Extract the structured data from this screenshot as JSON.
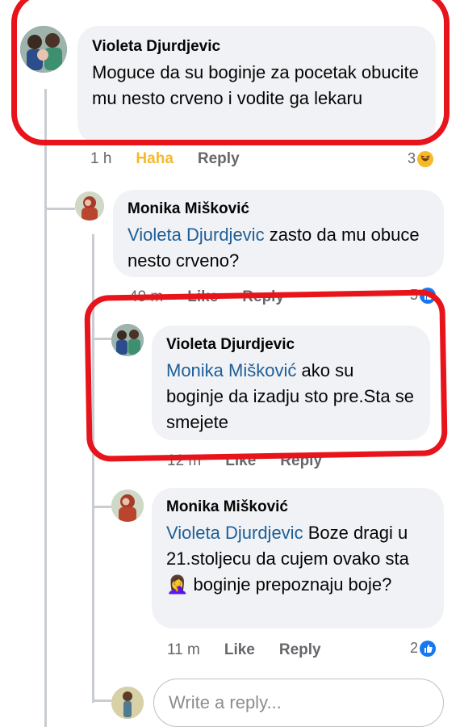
{
  "comments": [
    {
      "author": "Violeta Djurdjevic",
      "mention": "",
      "text": "Moguce da su boginje za pocetak obucite mu nesto crveno i vodite ga lekaru",
      "meta": {
        "time": "1 h",
        "haha": "Haha",
        "reply": "Reply"
      },
      "reaction_count": "3",
      "reaction_type": "haha-icon"
    },
    {
      "author": "Monika Mišković",
      "mention": "Violeta Djurdjevic",
      "text": " zasto da mu obuce nesto crveno?",
      "meta": {
        "time": "49 m",
        "like": "Like",
        "reply": "Reply"
      },
      "reaction_count": "5",
      "reaction_type": "like-icon"
    },
    {
      "author": "Violeta Djurdjevic",
      "mention": "Monika Mišković",
      "text": " ako su boginje da izadju sto pre.Sta se smejete",
      "meta": {
        "time": "12 m",
        "like": "Like",
        "reply": "Reply"
      }
    },
    {
      "author": "Monika Mišković",
      "mention": "Violeta Djurdjevic",
      "text_part1": " Boze dragi u 21.stoljecu da cujem ovako sta ",
      "emoji": "🤦‍♀️",
      "text_part2": " boginje prepoznaju boje?",
      "meta": {
        "time": "11 m",
        "like": "Like",
        "reply": "Reply"
      },
      "reaction_count": "2",
      "reaction_type": "like-icon"
    }
  ],
  "reply_input": {
    "placeholder": "Write a reply..."
  },
  "colors": {
    "annotation": "#e8141b",
    "mention": "#1f5e97",
    "bubble": "#f0f2f5"
  }
}
